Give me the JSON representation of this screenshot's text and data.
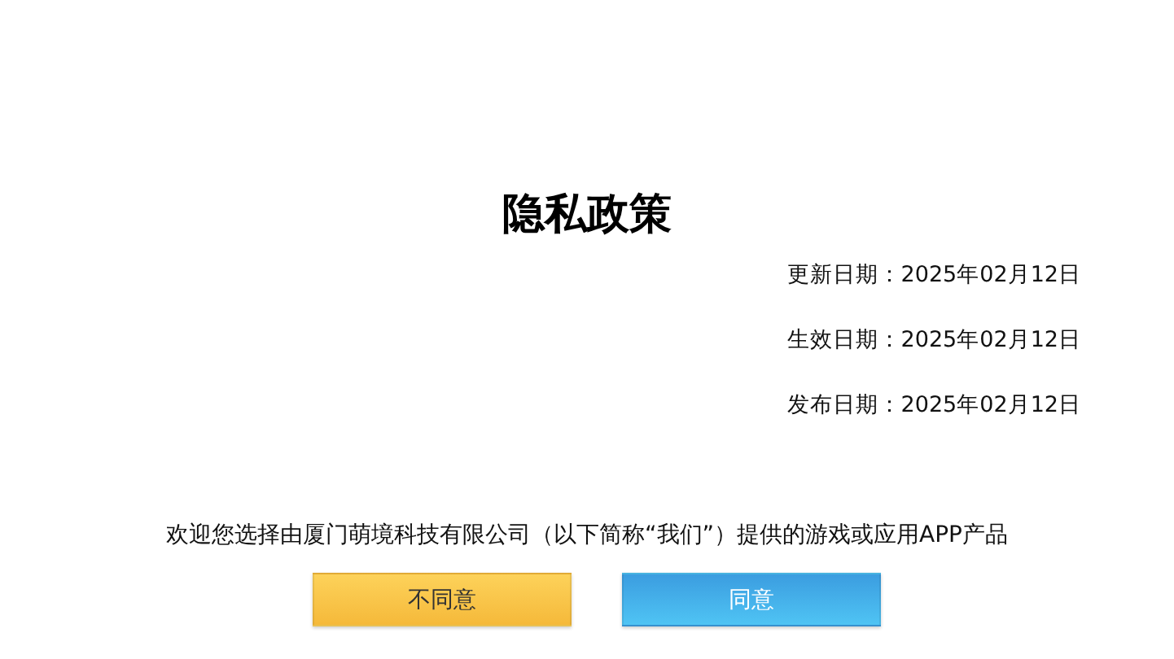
{
  "title": "隐私政策",
  "dates": [
    {
      "label": "更新日期：2025年02月12日"
    },
    {
      "label": "生效日期：2025年02月12日"
    },
    {
      "label": "发布日期：2025年02月12日"
    }
  ],
  "intro": "欢迎您选择由厦门萌境科技有限公司（以下简称“我们”）提供的游戏或应用APP产品",
  "buttons": [
    {
      "label": "不同意",
      "kind": "decline"
    },
    {
      "label": "同意",
      "kind": "accept"
    }
  ]
}
